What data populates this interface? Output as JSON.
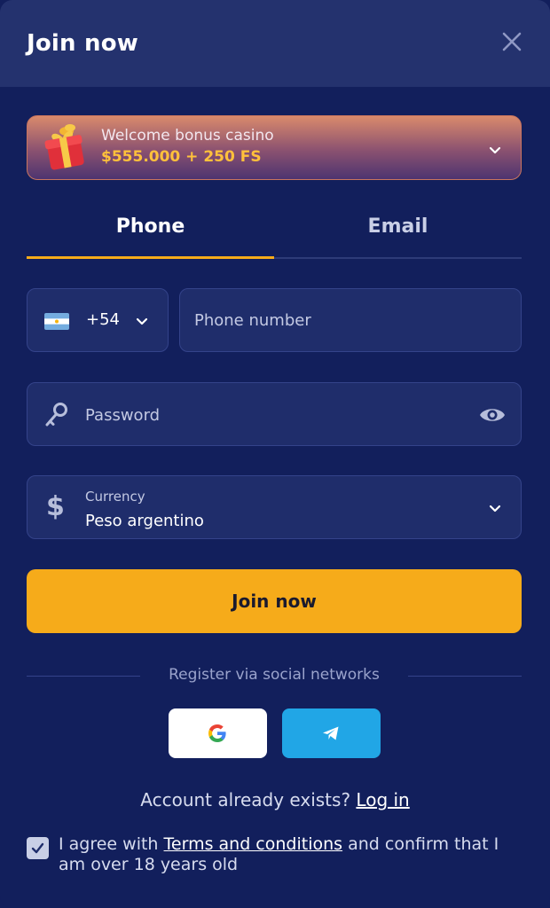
{
  "header": {
    "title": "Join now",
    "close_icon": "close-icon"
  },
  "bonus": {
    "line1": "Welcome bonus casino",
    "line2": "$555.000 + 250 FS",
    "icon": "gift-icon"
  },
  "tabs": [
    {
      "label": "Phone",
      "active": true
    },
    {
      "label": "Email",
      "active": false
    }
  ],
  "phone": {
    "country_code": "+54",
    "flag": "argentina-flag-icon",
    "placeholder": "Phone number"
  },
  "password": {
    "placeholder": "Password",
    "icon": "key-icon",
    "toggle_icon": "eye-icon"
  },
  "currency": {
    "label": "Currency",
    "value": "Peso argentino",
    "symbol": "$"
  },
  "join_button": "Join now",
  "social": {
    "label": "Register via social networks",
    "providers": [
      "Google",
      "Telegram"
    ]
  },
  "account": {
    "text": "Account already exists?",
    "link": "Log in"
  },
  "agreement": {
    "checked": true,
    "before": "I agree with",
    "link": "Terms and conditions",
    "after": "and confirm that I am over 18 years old"
  },
  "colors": {
    "background": "#121f5c",
    "header": "#24326e",
    "accent": "#f6ab1a",
    "bonus_amount": "#ffc13b",
    "telegram": "#21a6e6"
  }
}
